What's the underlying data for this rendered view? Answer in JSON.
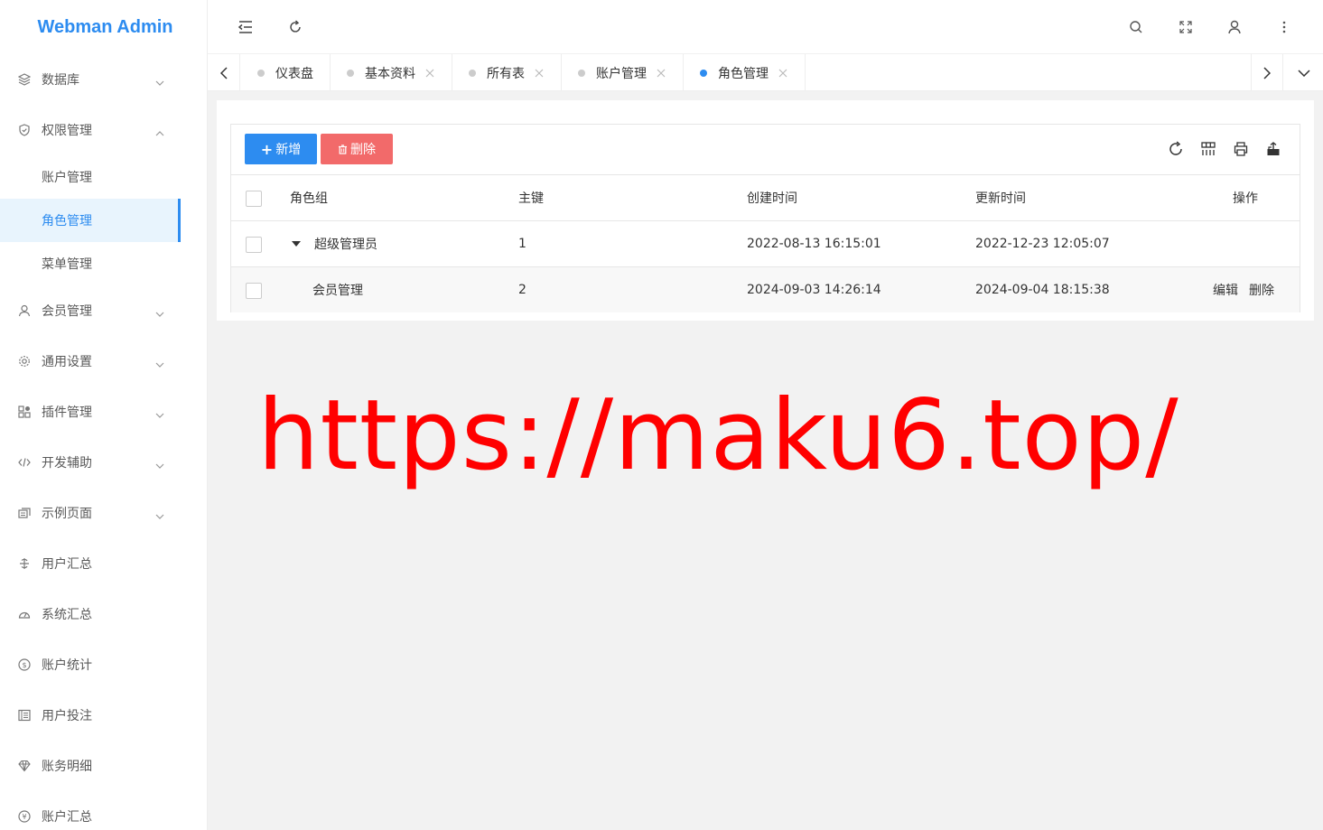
{
  "app": {
    "title": "Webman Admin"
  },
  "sidebar": {
    "items": [
      {
        "label": "数据库",
        "icon": "layers-icon",
        "has_arrow": true
      },
      {
        "label": "权限管理",
        "icon": "shield-icon",
        "expanded": true,
        "children": [
          {
            "label": "账户管理",
            "active": false
          },
          {
            "label": "角色管理",
            "active": true
          },
          {
            "label": "菜单管理",
            "active": false
          }
        ]
      },
      {
        "label": "会员管理",
        "icon": "user-icon",
        "has_arrow": true
      },
      {
        "label": "通用设置",
        "icon": "gear-icon",
        "has_arrow": true
      },
      {
        "label": "插件管理",
        "icon": "apps-icon",
        "has_arrow": true
      },
      {
        "label": "开发辅助",
        "icon": "code-icon",
        "has_arrow": true
      },
      {
        "label": "示例页面",
        "icon": "template-icon",
        "has_arrow": true
      },
      {
        "label": "用户汇总",
        "icon": "currency-icon",
        "has_arrow": false
      },
      {
        "label": "系统汇总",
        "icon": "dashboard-icon",
        "has_arrow": false
      },
      {
        "label": "账户统计",
        "icon": "dollar-icon",
        "has_arrow": false
      },
      {
        "label": "用户投注",
        "icon": "list-icon",
        "has_arrow": false
      },
      {
        "label": "账务明细",
        "icon": "diamond-icon",
        "has_arrow": false
      },
      {
        "label": "账户汇总",
        "icon": "yen-icon",
        "has_arrow": false
      }
    ]
  },
  "tabs": [
    {
      "label": "仪表盘",
      "closable": false,
      "active": false
    },
    {
      "label": "基本资料",
      "closable": true,
      "active": false
    },
    {
      "label": "所有表",
      "closable": true,
      "active": false
    },
    {
      "label": "账户管理",
      "closable": true,
      "active": false
    },
    {
      "label": "角色管理",
      "closable": true,
      "active": true
    }
  ],
  "toolbar": {
    "add_label": "新增",
    "delete_label": "删除"
  },
  "table": {
    "columns": [
      "角色组",
      "主键",
      "创建时间",
      "更新时间",
      "操作"
    ],
    "rows": [
      {
        "name": "超级管理员",
        "id": "1",
        "created": "2022-08-13 16:15:01",
        "updated": "2022-12-23 12:05:07",
        "actions": []
      },
      {
        "name": "会员管理",
        "id": "2",
        "created": "2024-09-03 14:26:14",
        "updated": "2024-09-04 18:15:38",
        "actions": [
          "编辑",
          "删除"
        ]
      }
    ]
  },
  "watermark": "https://maku6.top/",
  "colors": {
    "brand": "#2d8cf0",
    "danger": "#f26a6a",
    "watermark": "#ff0000"
  }
}
